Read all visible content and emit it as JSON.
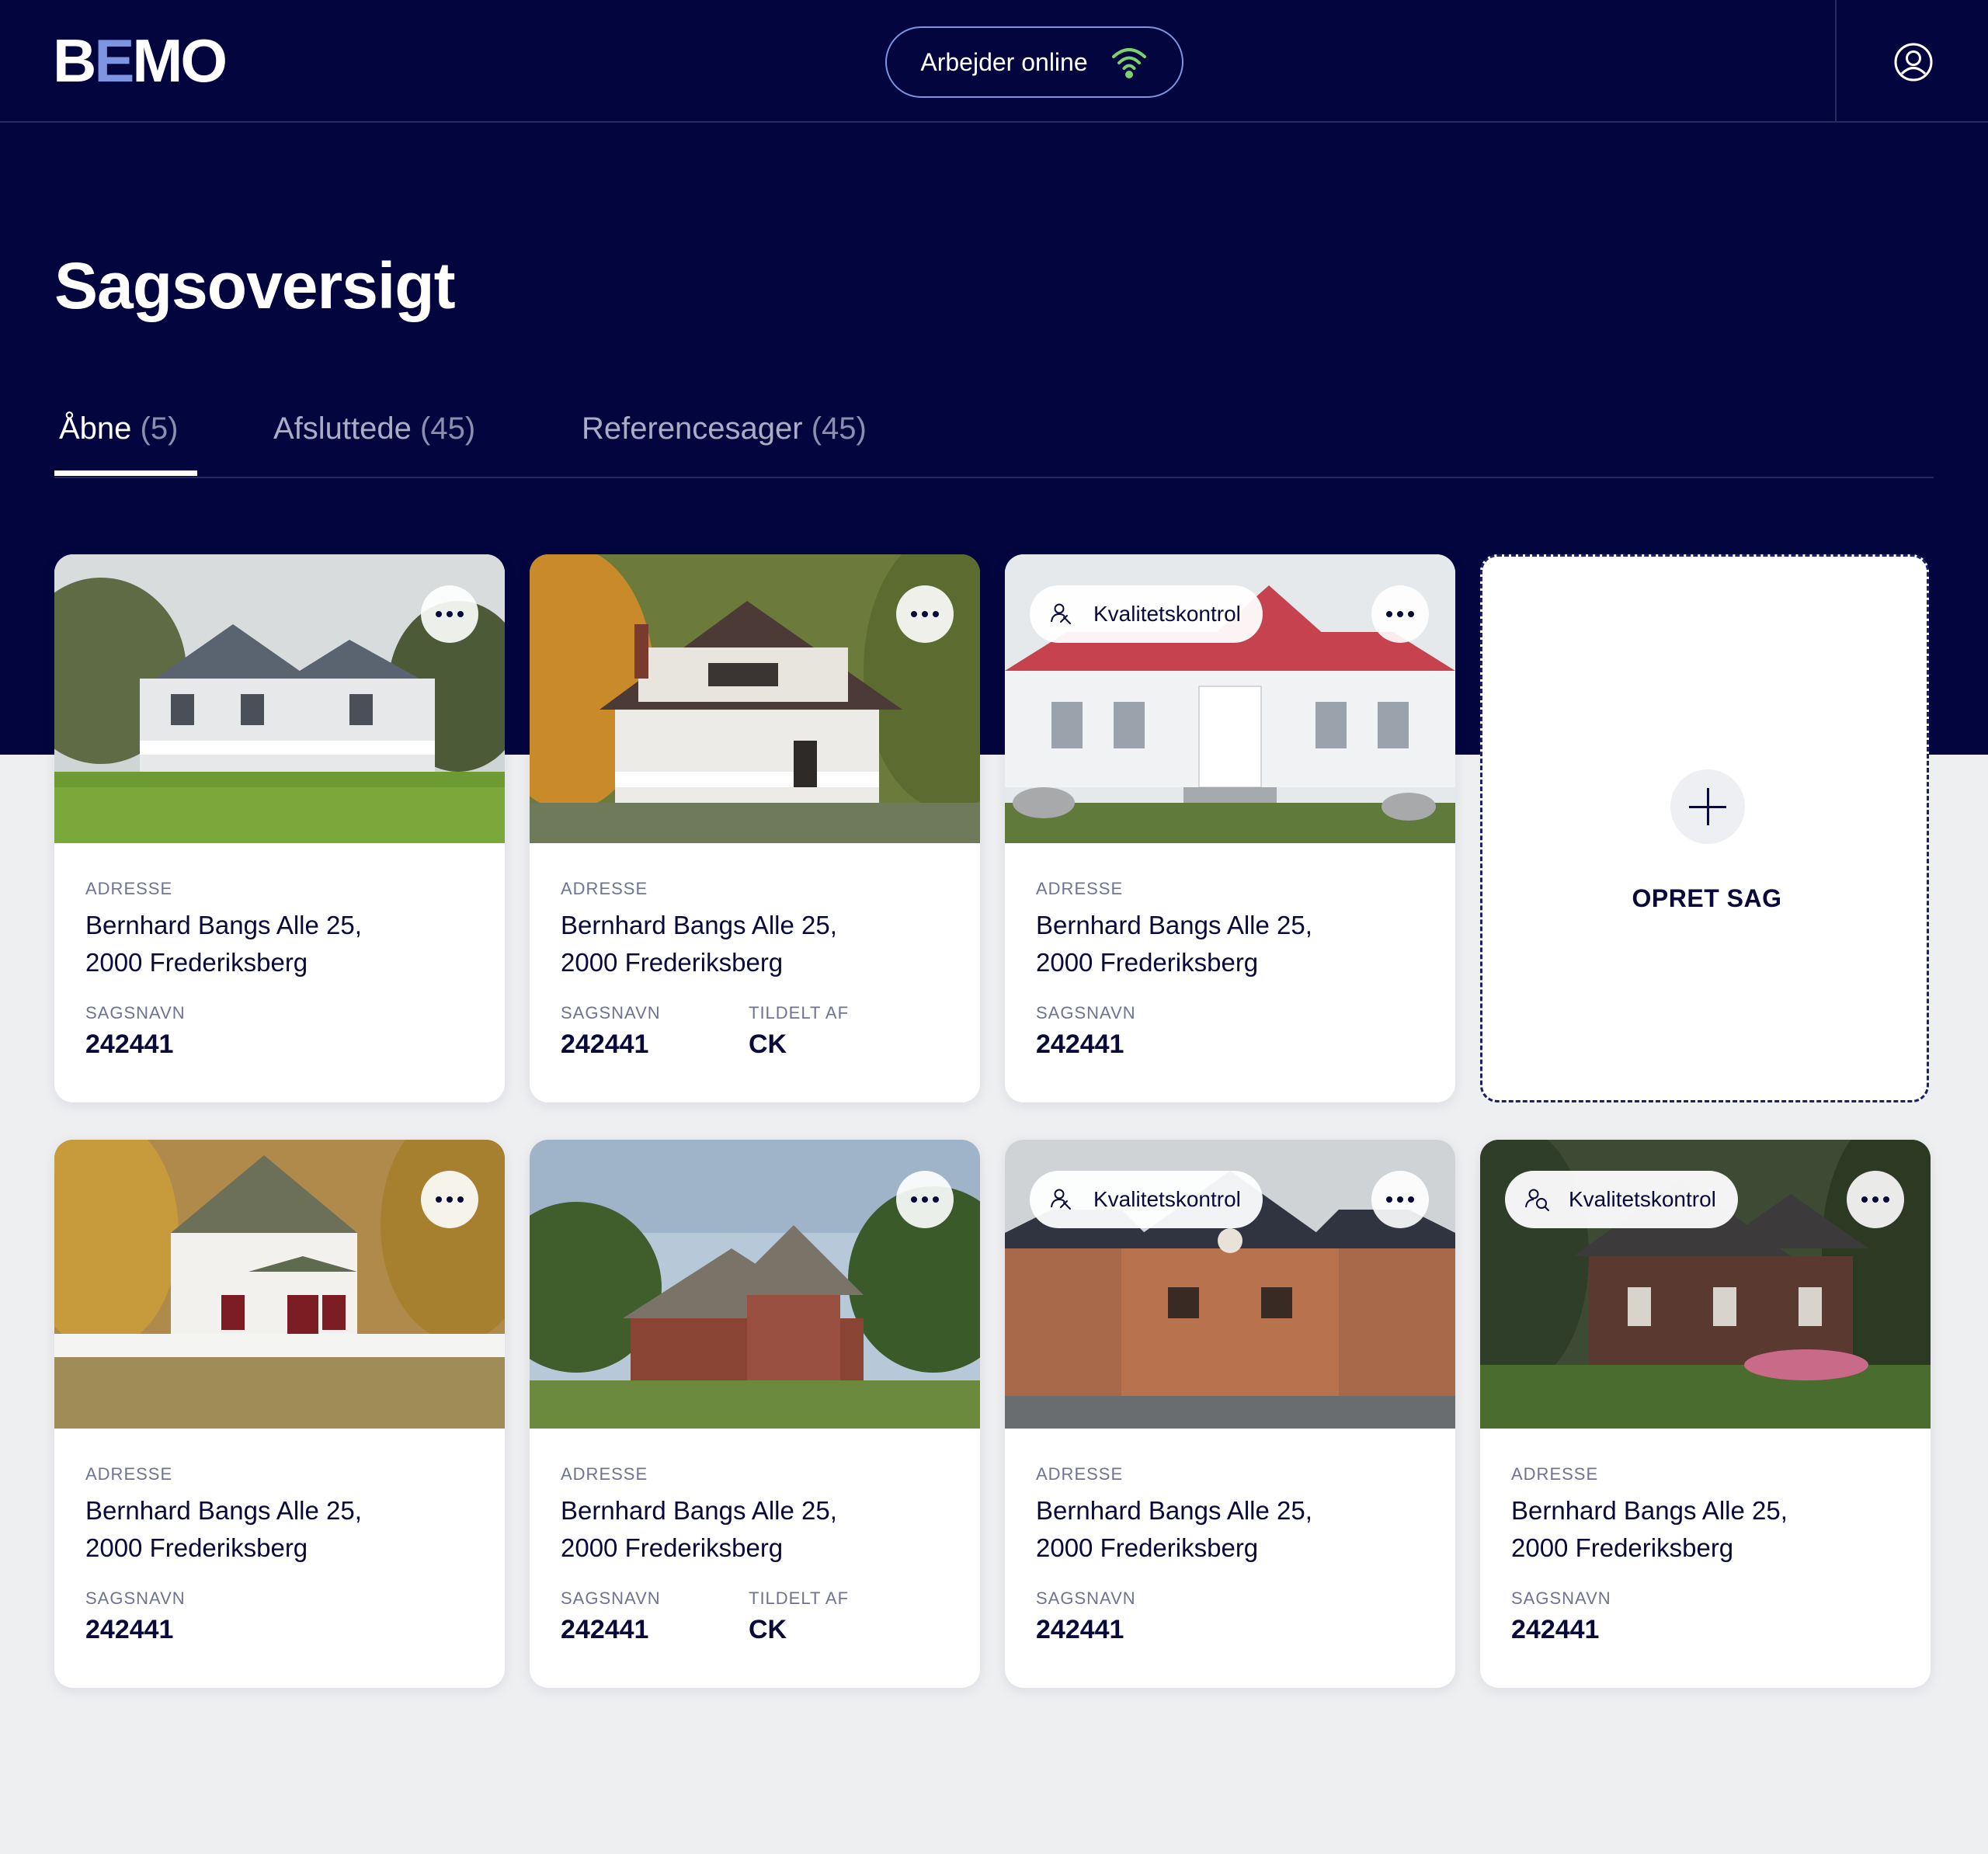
{
  "header": {
    "logo_left": "B",
    "logo_mid": "E",
    "logo_right": "MO",
    "status_label": "Arbejder online",
    "status_icon": "wifi-icon",
    "status_color": "#7bd36f",
    "user_icon": "user-icon"
  },
  "page": {
    "title": "Sagsoversigt"
  },
  "tabs": [
    {
      "label": "Åbne",
      "count": "(5)"
    },
    {
      "label": "Afsluttede",
      "count": "(45)"
    },
    {
      "label": "Referencesager",
      "count": "(45)"
    }
  ],
  "create": {
    "label": "OPRET SAG"
  },
  "cards": [
    {
      "badge": "",
      "address_label": "ADRESSE",
      "address_line1": "Bernhard Bangs Alle 25,",
      "address_line2": "2000 Frederiksberg",
      "case_label": "SAGSNAVN",
      "case_value": "242441",
      "assigned_label": "",
      "assigned_value": ""
    },
    {
      "badge": "",
      "address_label": "ADRESSE",
      "address_line1": "Bernhard Bangs Alle 25,",
      "address_line2": "2000 Frederiksberg",
      "case_label": "SAGSNAVN",
      "case_value": "242441",
      "assigned_label": "TILDELT AF",
      "assigned_value": "CK"
    },
    {
      "badge": "Kvalitetskontrol",
      "address_label": "ADRESSE",
      "address_line1": "Bernhard Bangs Alle 25,",
      "address_line2": "2000 Frederiksberg",
      "case_label": "SAGSNAVN",
      "case_value": "242441",
      "assigned_label": "",
      "assigned_value": ""
    },
    {
      "badge": "",
      "address_label": "ADRESSE",
      "address_line1": "Bernhard Bangs Alle 25,",
      "address_line2": "2000 Frederiksberg",
      "case_label": "SAGSNAVN",
      "case_value": "242441",
      "assigned_label": "",
      "assigned_value": ""
    },
    {
      "badge": "",
      "address_label": "ADRESSE",
      "address_line1": "Bernhard Bangs Alle 25,",
      "address_line2": "2000 Frederiksberg",
      "case_label": "SAGSNAVN",
      "case_value": "242441",
      "assigned_label": "TILDELT AF",
      "assigned_value": "CK"
    },
    {
      "badge": "Kvalitetskontrol",
      "address_label": "ADRESSE",
      "address_line1": "Bernhard Bangs Alle 25,",
      "address_line2": "2000 Frederiksberg",
      "case_label": "SAGSNAVN",
      "case_value": "242441",
      "assigned_label": "",
      "assigned_value": ""
    },
    {
      "badge": "Kvalitetskontrol",
      "address_label": "ADRESSE",
      "address_line1": "Bernhard Bangs Alle 25,",
      "address_line2": "2000 Frederiksberg",
      "case_label": "SAGSNAVN",
      "case_value": "242441",
      "assigned_label": "",
      "assigned_value": ""
    }
  ]
}
